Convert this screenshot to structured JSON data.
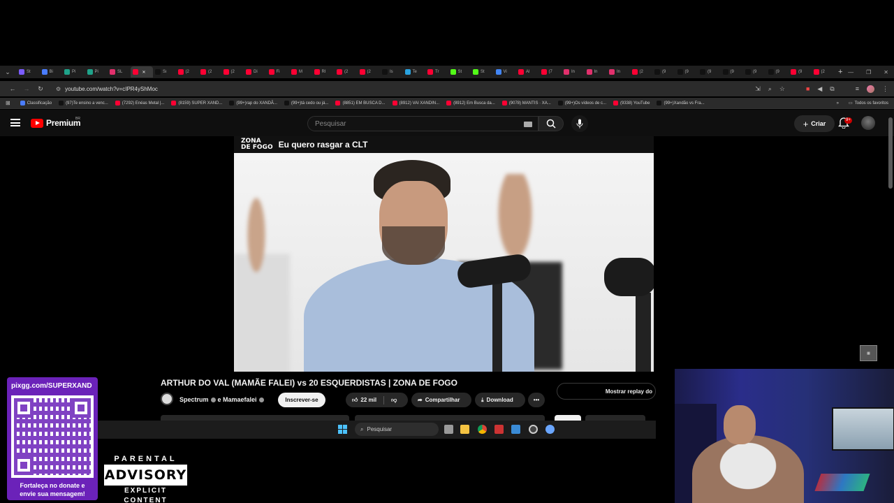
{
  "browser": {
    "tabs": [
      {
        "label": "St",
        "color": "#7b5cff"
      },
      {
        "label": "Bi",
        "color": "#4a7dff"
      },
      {
        "label": "Pi",
        "color": "#1fa38a"
      },
      {
        "label": "Pi",
        "color": "#1fa38a"
      },
      {
        "label": "SL",
        "color": "#e1306c"
      },
      {
        "label": "",
        "color": "#ff0033",
        "active": true
      },
      {
        "label": "Sı",
        "color": "#111111"
      },
      {
        "label": "(2",
        "color": "#ff0033"
      },
      {
        "label": "(2",
        "color": "#ff0033"
      },
      {
        "label": "(2",
        "color": "#ff0033"
      },
      {
        "label": "Di",
        "color": "#ff0033"
      },
      {
        "label": "Fi",
        "color": "#ff0033"
      },
      {
        "label": "M",
        "color": "#ff0033"
      },
      {
        "label": "RI",
        "color": "#ff0033"
      },
      {
        "label": "(2",
        "color": "#ff0033"
      },
      {
        "label": "(2",
        "color": "#ff0033"
      },
      {
        "label": "Is",
        "color": "#111111"
      },
      {
        "label": "Te",
        "color": "#2aa3e0"
      },
      {
        "label": "Tr",
        "color": "#ff0033"
      },
      {
        "label": "St",
        "color": "#53fc18"
      },
      {
        "label": "St",
        "color": "#53fc18"
      },
      {
        "label": "Vi",
        "color": "#4285f4"
      },
      {
        "label": "Al",
        "color": "#ff0033"
      },
      {
        "label": "(7",
        "color": "#ff0033"
      },
      {
        "label": "In",
        "color": "#e1306c"
      },
      {
        "label": "In",
        "color": "#e1306c"
      },
      {
        "label": "In",
        "color": "#e1306c"
      },
      {
        "label": "(2",
        "color": "#ff0033"
      },
      {
        "label": "(9",
        "color": "#111111"
      },
      {
        "label": "(9",
        "color": "#111111"
      },
      {
        "label": "(9",
        "color": "#111111"
      },
      {
        "label": "(9",
        "color": "#111111"
      },
      {
        "label": "(9",
        "color": "#111111"
      },
      {
        "label": "(9",
        "color": "#111111"
      },
      {
        "label": "(9",
        "color": "#ff0033"
      },
      {
        "label": "(2",
        "color": "#ff0033"
      }
    ],
    "url": "youtube.com/watch?v=cIPR4yShMoc",
    "bookmarks": [
      {
        "label": "Classificação",
        "color": "#4a7dff"
      },
      {
        "label": "(97)Te ensino a venc...",
        "color": "#111111"
      },
      {
        "label": "(7292) Enéas Metal |...",
        "color": "#ff0033"
      },
      {
        "label": "(8159) SUPER XAND...",
        "color": "#ff0033"
      },
      {
        "label": "(99+)rap do XANDÃ...",
        "color": "#111111"
      },
      {
        "label": "(99+)tá cedo ou já...",
        "color": "#111111"
      },
      {
        "label": "(8851) EM BUSCA D...",
        "color": "#ff0033"
      },
      {
        "label": "(8912) VAI XANDIN...",
        "color": "#ff0033"
      },
      {
        "label": "(8912) Em Busca da...",
        "color": "#ff0033"
      },
      {
        "label": "(9078) MANTIS · XA...",
        "color": "#ff0033"
      },
      {
        "label": "(99+)Os vídeos de c...",
        "color": "#111111"
      },
      {
        "label": "(9338) YouTube",
        "color": "#ff0033"
      },
      {
        "label": "(99+)Xandão vs Fra...",
        "color": "#111111"
      }
    ],
    "all_bookmarks": "Todos os favoritos"
  },
  "youtube": {
    "logo": "Premium",
    "region": "BR",
    "search_placeholder": "Pesquisar",
    "create_label": "Criar",
    "notification_count": "9+"
  },
  "video": {
    "overlay_logo_top": "ZONA",
    "overlay_logo_bottom": "DE FOGO",
    "overlay_caption": "Eu quero rasgar a CLT",
    "title": "ARTHUR DO VAL (MAMÃE FALEI) vs 20 ESQUERDISTAS | ZONA DE FOGO",
    "channel": "Spectrum",
    "collab": "e Mamaefalei",
    "subscribe_label": "Inscrever-se",
    "likes": "22 mil",
    "share_label": "Compartilhar",
    "download_label": "Download",
    "replay_label": "Mostrar replay do"
  },
  "taskbar": {
    "search_placeholder": "Pesquisar"
  },
  "stream_overlay": {
    "qr_url": "pixgg.com/SUPERXAND",
    "qr_caption_line1": "Fortaleça no donate e",
    "qr_caption_line2": "envie sua mensagem!",
    "advisory_top": "PARENTAL",
    "advisory_mid": "ADVISORY",
    "advisory_bottom": "EXPLICIT CONTENT"
  }
}
